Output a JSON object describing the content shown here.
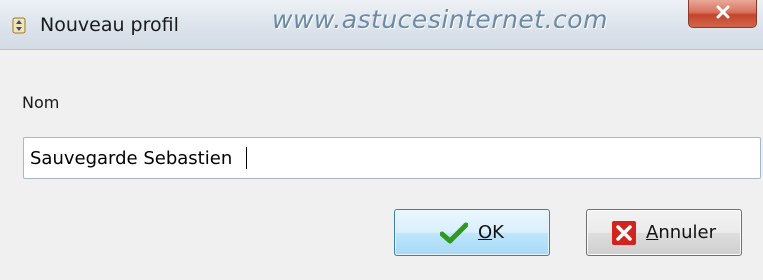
{
  "window": {
    "title": "Nouveau profil",
    "watermark": "www.astucesinternet.com",
    "icon": "app-icon",
    "close_icon": "close-icon"
  },
  "form": {
    "name_label": "Nom",
    "name_value": "Sauvegarde Sebastien"
  },
  "buttons": {
    "ok_label": "OK",
    "ok_mnemonic": "O",
    "ok_rest": "K",
    "ok_icon": "checkmark-icon",
    "cancel_label": "Annuler",
    "cancel_mnemonic": "A",
    "cancel_rest": "nnuler",
    "cancel_icon": "red-x-icon"
  },
  "colors": {
    "ok_border": "#3c7fb1",
    "close_red": "#c4442b",
    "check_green": "#2f9a1f",
    "cancel_red": "#d2231c"
  }
}
